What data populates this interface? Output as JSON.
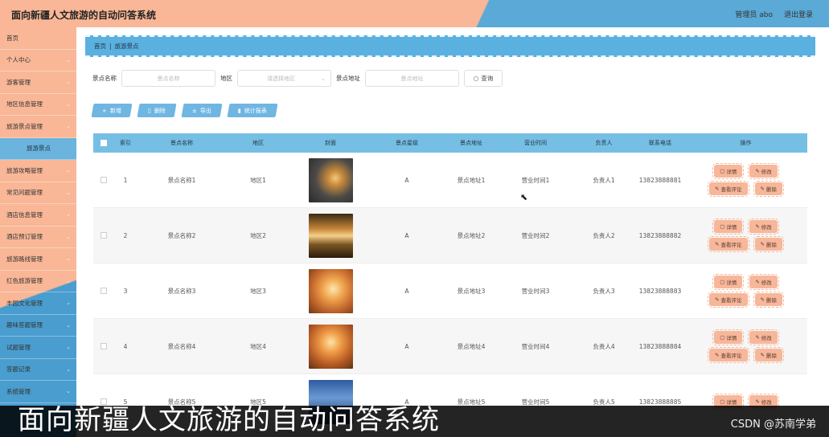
{
  "header": {
    "title": "面向新疆人文旅游的自动问答系统",
    "user_label": "管理员 abo",
    "logout_label": "退出登录"
  },
  "sidebar": {
    "items": [
      {
        "label": "首页",
        "chevron": ""
      },
      {
        "label": "个人中心",
        "chevron": "⌄"
      },
      {
        "label": "游客管理",
        "chevron": "⌄"
      },
      {
        "label": "地区信息管理",
        "chevron": "⌄"
      },
      {
        "label": "旅游景点管理",
        "chevron": "⌄"
      },
      {
        "label": "旅游景点",
        "chevron": ""
      },
      {
        "label": "旅游攻略管理",
        "chevron": "⌄"
      },
      {
        "label": "常见问题管理",
        "chevron": "⌄"
      },
      {
        "label": "酒店信息管理",
        "chevron": "⌄"
      },
      {
        "label": "酒店预订管理",
        "chevron": "⌄"
      },
      {
        "label": "旅游路线管理",
        "chevron": "⌄"
      },
      {
        "label": "红色旅游管理",
        "chevron": "⌄"
      },
      {
        "label": "丰园文化管理",
        "chevron": "⌄"
      },
      {
        "label": "趣味答题管理",
        "chevron": "⌄"
      },
      {
        "label": "试题管理",
        "chevron": "⌄"
      },
      {
        "label": "答题记录",
        "chevron": "⌄"
      },
      {
        "label": "系统管理",
        "chevron": "⌄"
      }
    ]
  },
  "breadcrumb": {
    "home": "首页",
    "sep": "|",
    "current": "旅游景点"
  },
  "search": {
    "name_label": "景点名称",
    "name_placeholder": "景点名称",
    "area_label": "地区",
    "area_placeholder": "请选择地区",
    "addr_label": "景点地址",
    "addr_placeholder": "景点地址",
    "query_label": "查询"
  },
  "actions": {
    "add": "新增",
    "delete": "删除",
    "export": "导出",
    "report": "统计报表"
  },
  "table": {
    "headers": [
      "索引",
      "景点名称",
      "地区",
      "封面",
      "景点星级",
      "景点地址",
      "营业时间",
      "负责人",
      "联系电话",
      "操作"
    ],
    "rows": [
      {
        "idx": "1",
        "name": "景点名称1",
        "area": "地区1",
        "level": "A",
        "addr": "景点地址1",
        "time": "营业时间1",
        "owner": "负责人1",
        "phone": "13823888881"
      },
      {
        "idx": "2",
        "name": "景点名称2",
        "area": "地区2",
        "level": "A",
        "addr": "景点地址2",
        "time": "营业时间2",
        "owner": "负责人2",
        "phone": "13823888882"
      },
      {
        "idx": "3",
        "name": "景点名称3",
        "area": "地区3",
        "level": "A",
        "addr": "景点地址3",
        "time": "营业时间3",
        "owner": "负责人3",
        "phone": "13823888883"
      },
      {
        "idx": "4",
        "name": "景点名称4",
        "area": "地区4",
        "level": "A",
        "addr": "景点地址4",
        "time": "营业时间4",
        "owner": "负责人4",
        "phone": "13823888884"
      },
      {
        "idx": "5",
        "name": "景点名称5",
        "area": "地区5",
        "level": "A",
        "addr": "景点地址5",
        "time": "营业时间5",
        "owner": "负责人5",
        "phone": "13823888885"
      }
    ],
    "ops": {
      "detail": "详情",
      "edit": "修改",
      "comments": "查看评论",
      "delete": "删除"
    }
  },
  "caption": "面向新疆人文旅游的自动问答系统",
  "watermark": "CSDN @苏南学弟",
  "colors": {
    "accent_orange": "#f9b797",
    "accent_blue": "#5aa9d6"
  }
}
